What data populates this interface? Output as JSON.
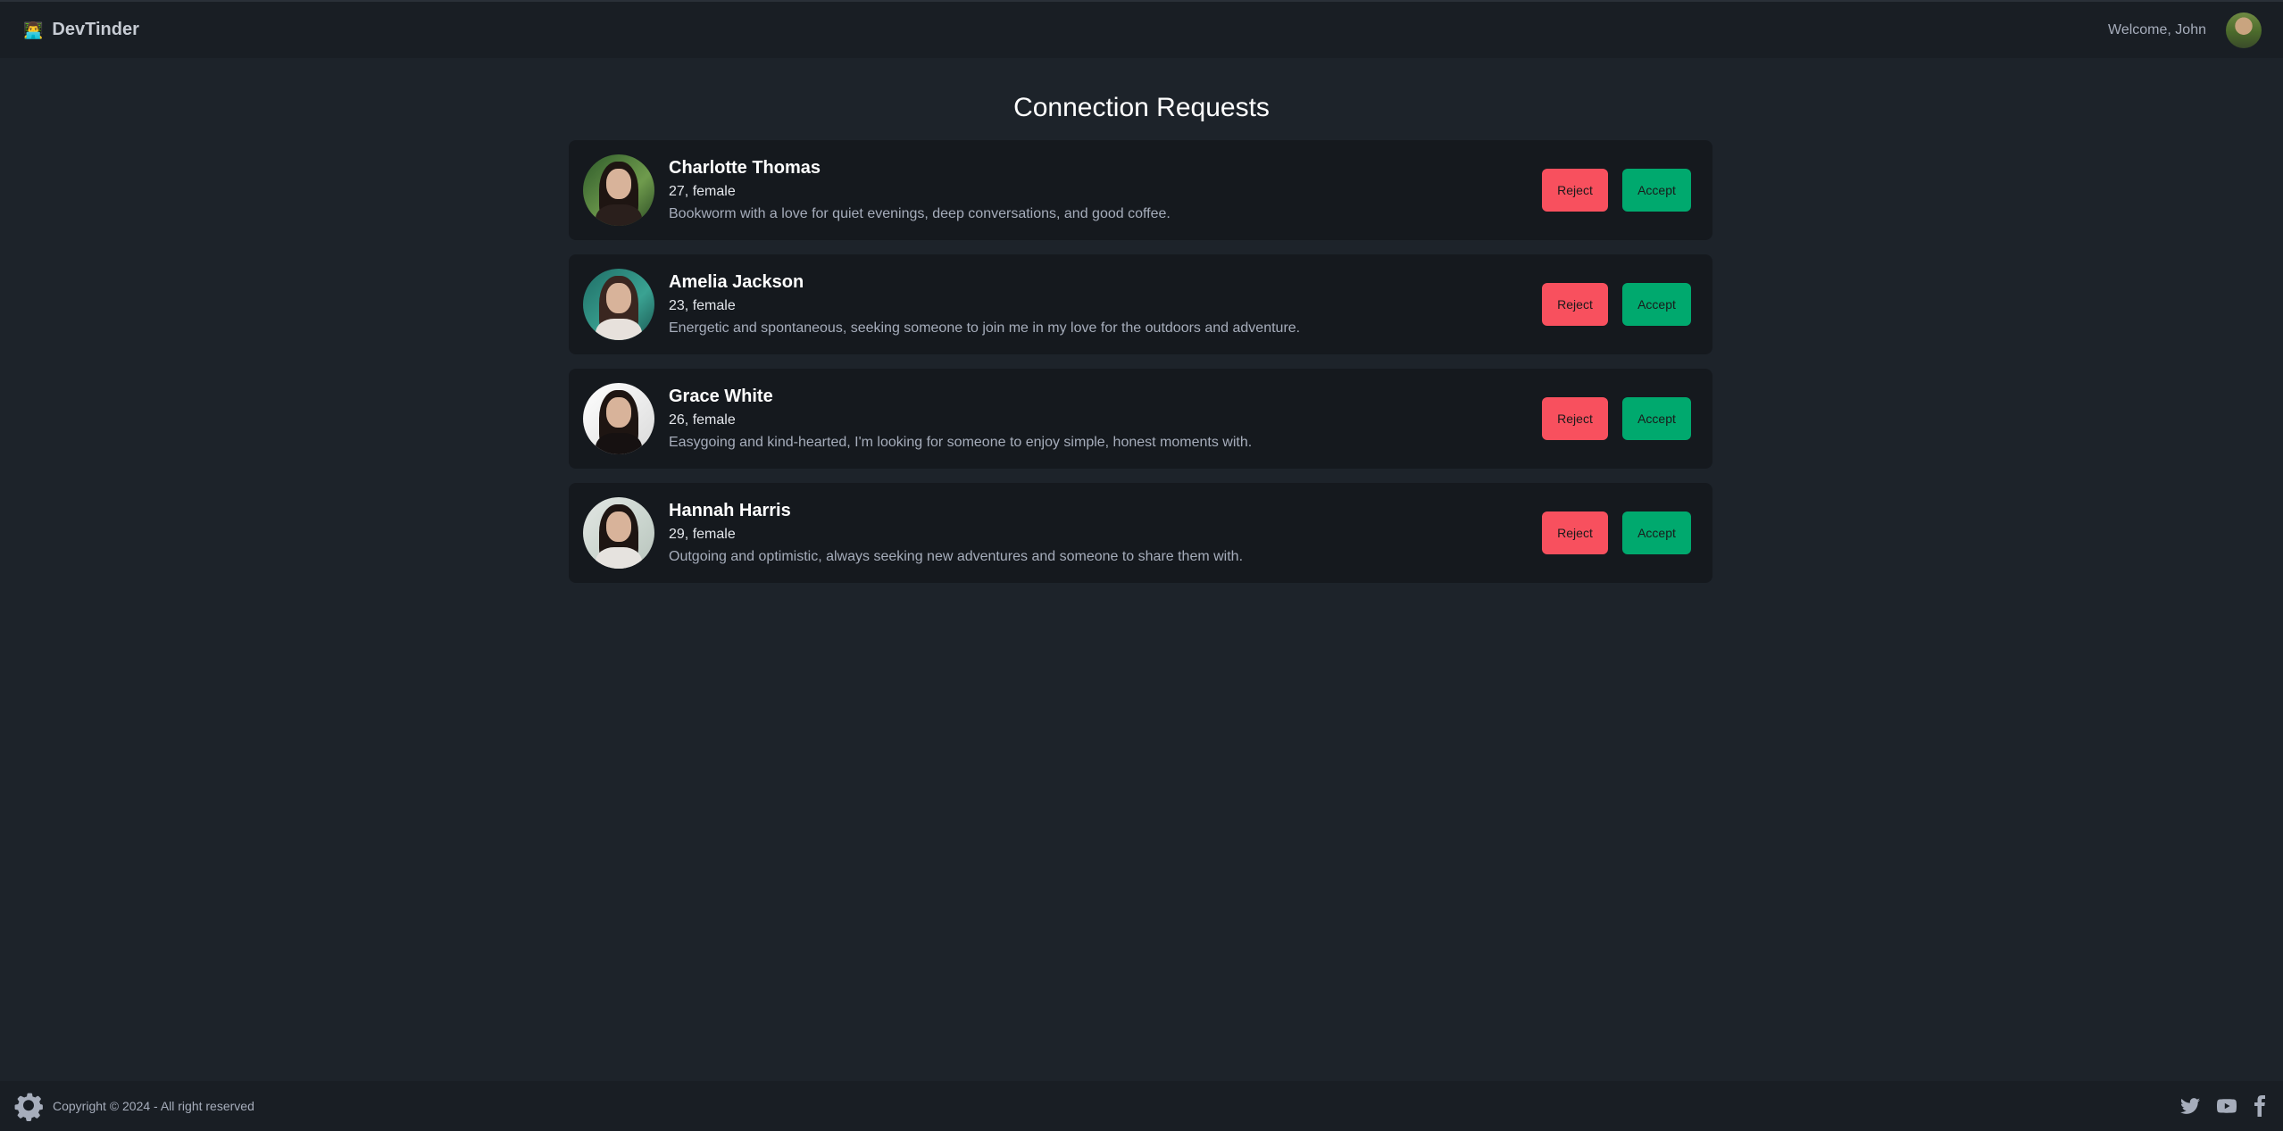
{
  "navbar": {
    "brand_icon": "👨‍💻",
    "brand_name": "DevTinder",
    "welcome": "Welcome, John"
  },
  "page": {
    "title": "Connection Requests"
  },
  "requests": [
    {
      "name": "Charlotte Thomas",
      "meta": "27, female",
      "bio": "Bookworm with a love for quiet evenings, deep conversations, and good coffee.",
      "reject_label": "Reject",
      "accept_label": "Accept"
    },
    {
      "name": "Amelia Jackson",
      "meta": "23, female",
      "bio": "Energetic and spontaneous, seeking someone to join me in my love for the outdoors and adventure.",
      "reject_label": "Reject",
      "accept_label": "Accept"
    },
    {
      "name": "Grace White",
      "meta": "26, female",
      "bio": "Easygoing and kind-hearted, I'm looking for someone to enjoy simple, honest moments with.",
      "reject_label": "Reject",
      "accept_label": "Accept"
    },
    {
      "name": "Hannah Harris",
      "meta": "29, female",
      "bio": "Outgoing and optimistic, always seeking new adventures and someone to share them with.",
      "reject_label": "Reject",
      "accept_label": "Accept"
    }
  ],
  "footer": {
    "copyright": "Copyright © 2024 - All right reserved",
    "icons": [
      "gear-logo-icon",
      "twitter-icon",
      "youtube-icon",
      "facebook-icon"
    ]
  },
  "colors": {
    "background": "#1d232a",
    "card": "#15191e",
    "reject": "#f8505e",
    "accept": "#00a96e"
  }
}
